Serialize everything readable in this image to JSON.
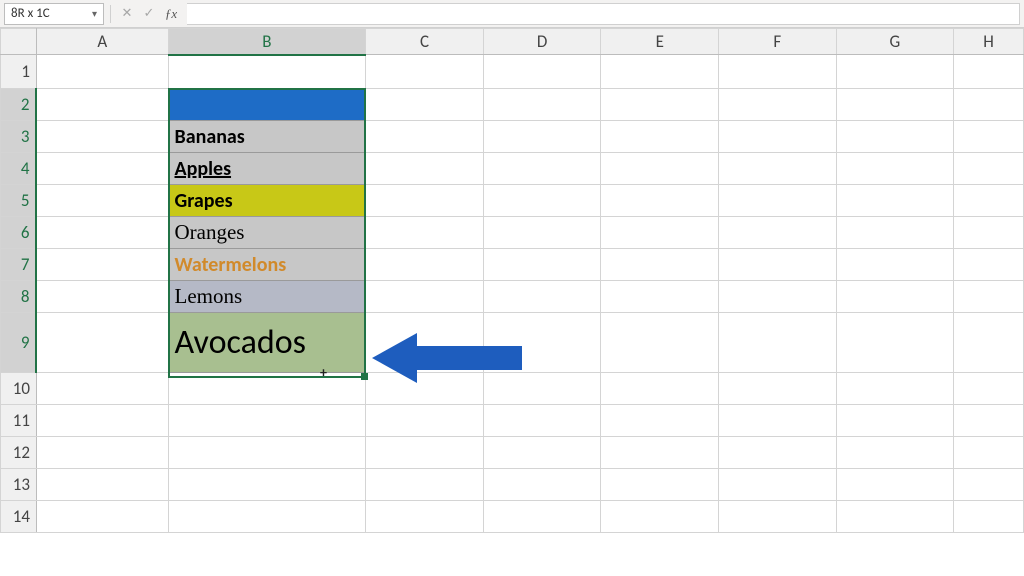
{
  "namebox": "8R x 1C",
  "formula_bar": {
    "value": ""
  },
  "columns": [
    "A",
    "B",
    "C",
    "D",
    "E",
    "F",
    "G",
    "H"
  ],
  "rows": [
    "1",
    "2",
    "3",
    "4",
    "5",
    "6",
    "7",
    "8",
    "9",
    "10",
    "11",
    "12",
    "13",
    "14"
  ],
  "selected_col": "B",
  "selected_rows_start": 2,
  "selected_rows_end": 9,
  "cells": {
    "B2": "",
    "B3": "Bananas",
    "B4": "Apples",
    "B5": "Grapes",
    "B6": "Oranges",
    "B7": "Watermelons",
    "B8": "Lemons",
    "B9": "Avocados"
  },
  "annotation": {
    "type": "arrow-left",
    "color": "#1E5DBE"
  }
}
